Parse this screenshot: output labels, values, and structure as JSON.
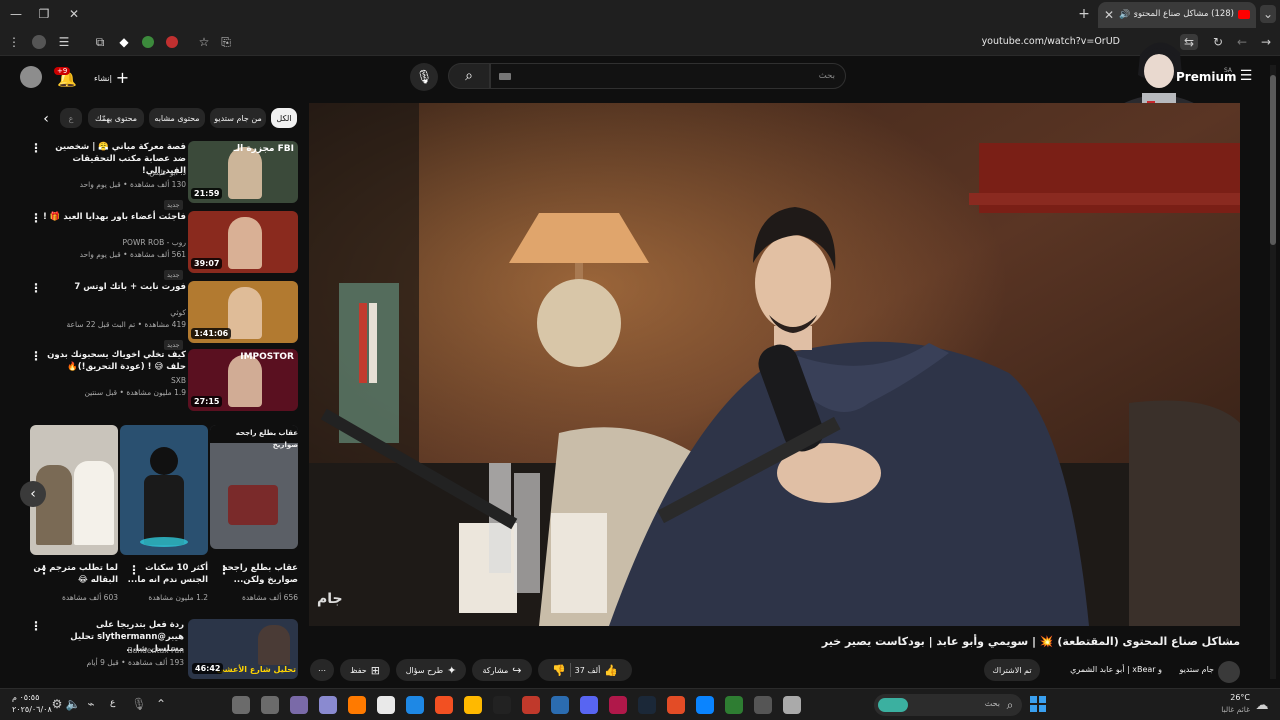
{
  "browser": {
    "tab_title": "(128) مشاكل صناع المحتوى (",
    "url": "youtube.com/watch?v=OrUD"
  },
  "header": {
    "search_placeholder": "بحث",
    "create_label": "إنشاء",
    "notif_count": "+9",
    "premium_label": "Premium",
    "premium_region": "SA"
  },
  "chips": [
    "الكل",
    "من جام ستديو",
    "محتوى مشابه",
    "محتوى يهمّك",
    "ع"
  ],
  "recs": [
    {
      "title": "قصة معركة مباني 😤 | شخصين ضد عصابة مكتب التحقيقات الفيدرالي!",
      "channel": "د. أبو عايض",
      "meta": "130 ألف مشاهدة • قبل يوم واحد",
      "badge": "جديد",
      "duration": "21:59",
      "thumb_text": "مجزرة الـ FBI",
      "thumb_color": "#3b4a3a"
    },
    {
      "title": "فاجئت أعضاء باور بهدايا العيد 🎁 !",
      "channel": "روب - POWR ROB",
      "meta": "561 ألف مشاهدة • قبل يوم واحد",
      "badge": "جديد",
      "duration": "39:07",
      "thumb_text": "",
      "thumb_color": "#8a2a1e"
    },
    {
      "title": "فورت نايت + باتك اوتس 7",
      "channel": "كوثي",
      "meta": "419 مشاهدة • تم البث قبل 22 ساعة",
      "badge": "جديد",
      "duration": "1:41:06",
      "thumb_text": "",
      "thumb_color": "#b27a30"
    },
    {
      "title": "كيف تخلي اخوياك يسحبونك بدون حلف 😅 ! (عودة التحريق!)🔥",
      "channel": "SXB",
      "meta": "1.9 مليون مشاهدة • قبل سنتين",
      "badge": "",
      "duration": "27:15",
      "thumb_text": "IMPOSTOR",
      "thumb_color": "#5a1020"
    }
  ],
  "shorts": [
    {
      "title": "عقاب بطلع راجحه صواريخ",
      "caption": "عقاب بطلع راجحه صواريخ ولكن...",
      "views": "656 ألف مشاهدة",
      "color": "#5b5f66"
    },
    {
      "title": "أكثر 10 سكنات الجنس ندم انه ما...",
      "caption": "أكثر 10 سكنات الجنس ندم انه ما...",
      "views": "1.2 مليون مشاهدة",
      "color": "#2a5070"
    },
    {
      "title": "لما تطلب مترجم من البقاله 😂",
      "caption": "لما تطلب مترجم من البقاله 😂",
      "views": "603 ألف مشاهدة",
      "color": "#c9c4bb"
    }
  ],
  "rec5": {
    "title": "ردة فعل بتدريجا على هيبر@slythermann تحليل مسلسل شا...",
    "channel": "Banderitax Fan",
    "meta": "193 ألف مشاهدة • قبل 9 أيام",
    "duration": "46:42",
    "thumb_text": "تحليل شارع الأعشى"
  },
  "video": {
    "title": "مشاكل صناع المحتوى (المقتطعة) 💥 | سويمي وأبو عابد | بودكاست يصير خير",
    "channel": "جام ستديو",
    "collab": "و xBear | أبو عابد الشمري",
    "subscribed_label": "تم الاشتراك",
    "likes": "37 ألف",
    "share_label": "مشاركة",
    "ask_label": "طرح سؤال",
    "save_label": "حفظ",
    "watermark": "جام"
  },
  "taskbar": {
    "time": "٠٥:٥٥ م",
    "date": "٢٠٢٥/٠٦/٠٨",
    "temp": "26°C",
    "weather": "غائم غالبا",
    "search_label": "بحث",
    "lang": "ع"
  }
}
